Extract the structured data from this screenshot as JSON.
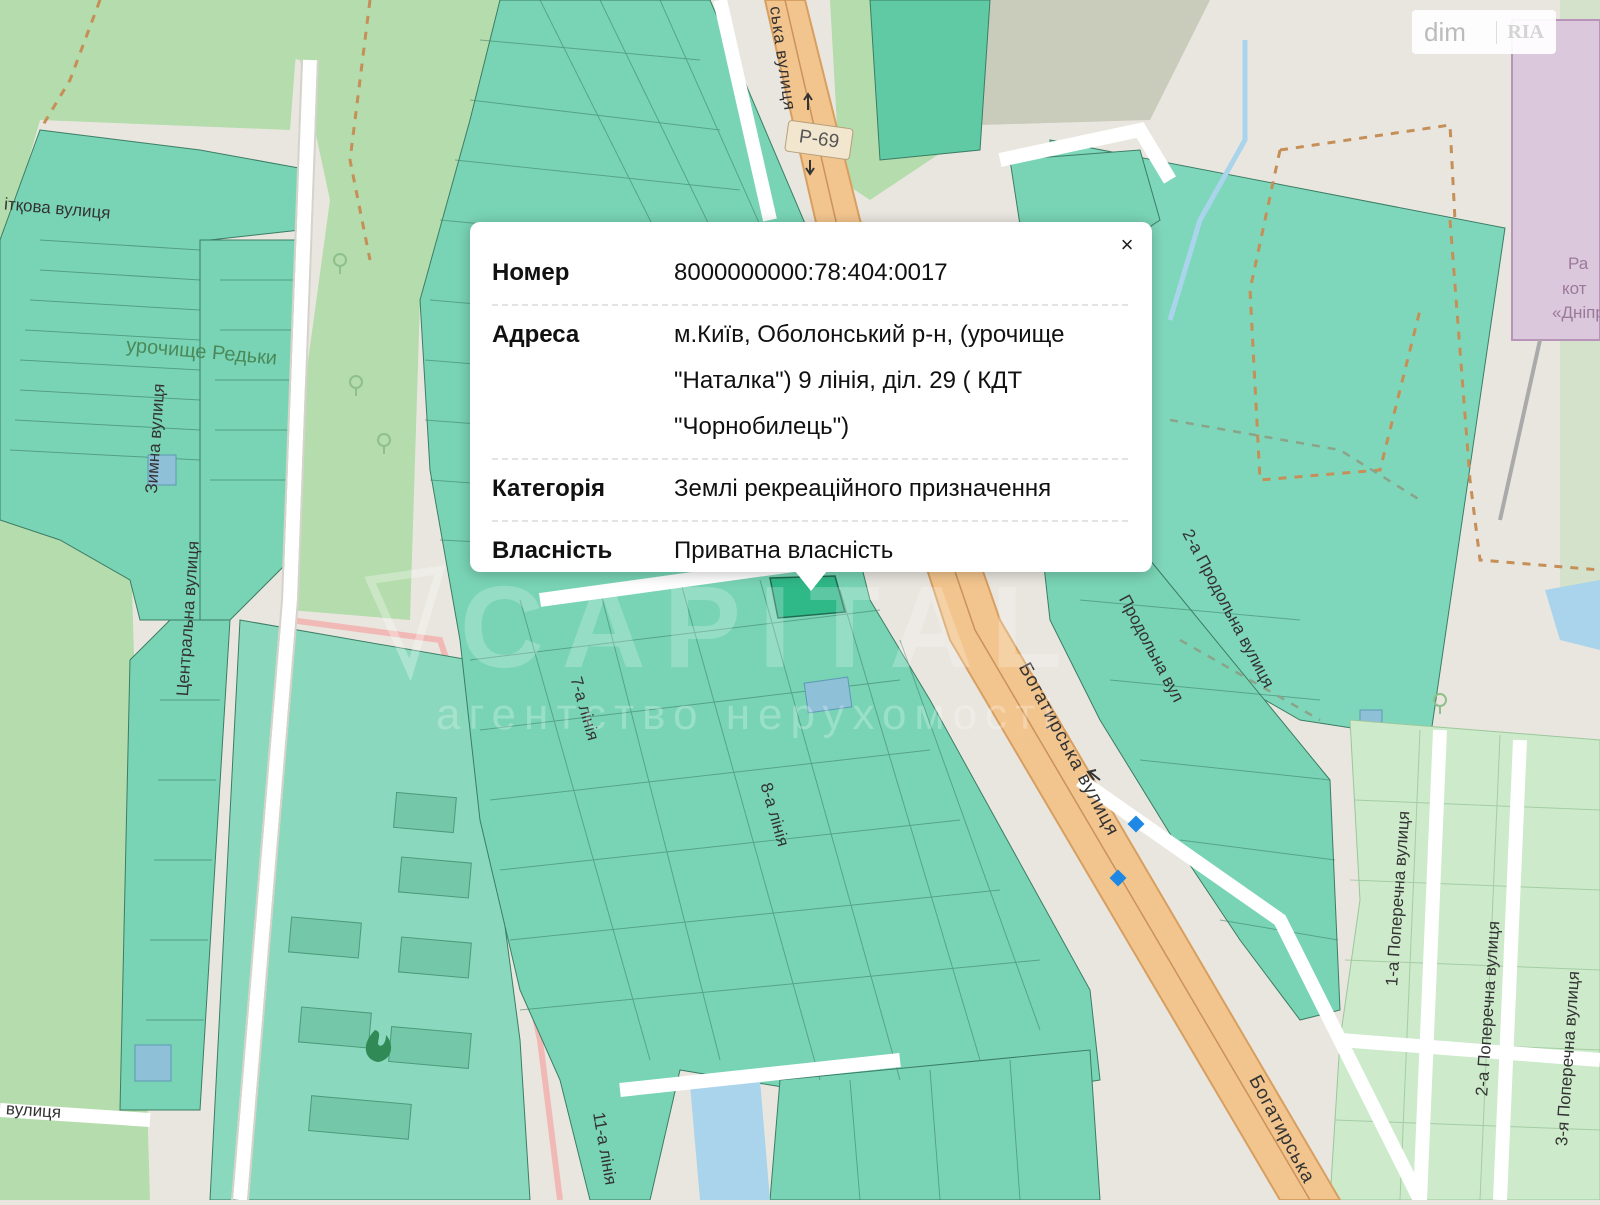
{
  "map": {
    "background_color": "#e9e6df",
    "parcel_color": "#79d4b5",
    "parcel_border_color": "#3b7d64",
    "selected_parcel_color": "#2fb888",
    "forest_color": "#a9d9a3",
    "road_color": "#f5c58a",
    "labels": {
      "street_vitkova": "ітқова вулиця",
      "street_tsentralna": "Центральна вулиця",
      "street_zhuravlynna": "Зимна вулиця",
      "urochyshche_redky": "урочище Редьки",
      "street_bottom_left": "вулиця",
      "street_bohatyrska_top": "ська вулиця",
      "street_bohatyrska_mid": "Богатирська вулиця",
      "street_bohatyrska_bottom": "Богатирська",
      "liniya_7": "7-а лінія",
      "liniya_8": "8-а лінія",
      "liniya_11": "11-а лінія",
      "street_2_prodolna_a": "2-а Продольна вулиця",
      "street_2_prodolna_b": "Продольна вул",
      "street_1_poperechna": "1-а Поперечна вулиця",
      "street_2_poperechna": "2-а Поперечна вулиця",
      "street_3_poperechna": "3-я Поперечна вулиця",
      "right_edge_1": "Ра",
      "right_edge_2": "кот",
      "right_edge_3": "«Дніпро"
    },
    "route_shield": "Р-69",
    "background_logo_word": "CAPITAL",
    "background_logo_sub": "агентство нерухомості"
  },
  "watermark": {
    "brand": "dim",
    "brand_suffix": "RIA"
  },
  "popup": {
    "close_glyph": "×",
    "rows": [
      {
        "label": "Номер",
        "value": "8000000000:78:404:0017"
      },
      {
        "label": "Адреса",
        "value": "м.Київ, Оболонський р-н, (урочище \"Наталка\") 9 лінія, діл. 29 ( КДТ \"Чорнобилець\")"
      },
      {
        "label": "Категорія",
        "value": "Землі рекреаційного призначення"
      },
      {
        "label": "Власність",
        "value": "Приватна власність"
      }
    ]
  }
}
